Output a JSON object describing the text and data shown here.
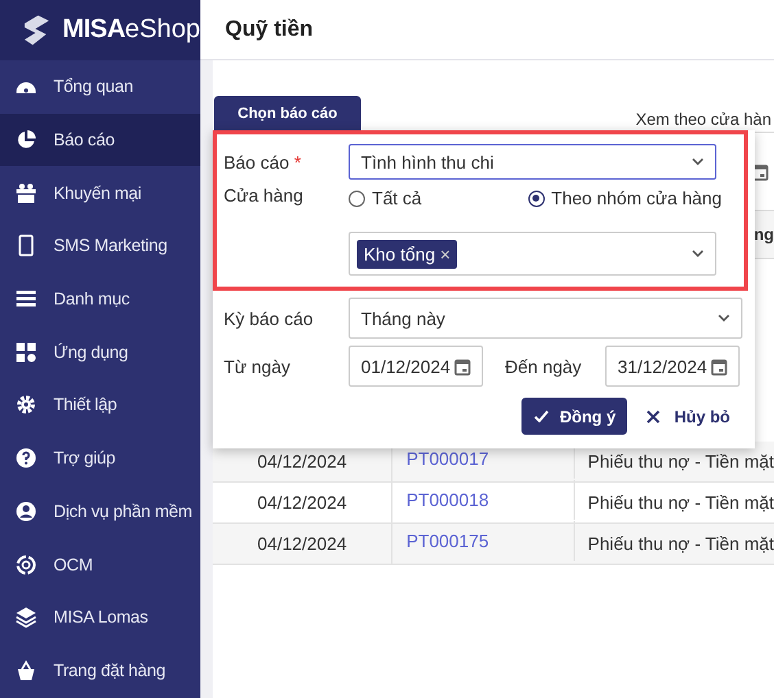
{
  "logo": {
    "brand": "MISA",
    "product": "eShop"
  },
  "sidebar": {
    "items": [
      {
        "label": "Tổng quan",
        "selected": false
      },
      {
        "label": "Báo cáo",
        "selected": true
      },
      {
        "label": "Khuyến mại",
        "selected": false
      },
      {
        "label": "SMS Marketing",
        "selected": false
      },
      {
        "label": "Danh mục",
        "selected": false
      },
      {
        "label": "Ứng dụng",
        "selected": false
      },
      {
        "label": "Thiết lập",
        "selected": false
      },
      {
        "label": "Trợ giúp",
        "selected": false
      },
      {
        "label": "Dịch vụ phần mềm",
        "selected": false
      },
      {
        "label": "OCM",
        "selected": false
      },
      {
        "label": "MISA Lomas",
        "selected": false
      },
      {
        "label": "Trang đặt hàng",
        "selected": false
      }
    ]
  },
  "page_title": "Quỹ tiền",
  "tab": {
    "label": "Chọn báo cáo"
  },
  "background": {
    "view_by": "Xem theo cửa hàn",
    "column_header": "ng"
  },
  "table": {
    "rows": [
      {
        "date": "04/12/2024",
        "code": "PT000017",
        "description": "Phiếu thu nợ - Tiền mặt"
      },
      {
        "date": "04/12/2024",
        "code": "PT000018",
        "description": "Phiếu thu nợ - Tiền mặt"
      },
      {
        "date": "04/12/2024",
        "code": "PT000175",
        "description": "Phiếu thu nợ - Tiền mặt"
      }
    ]
  },
  "dialog": {
    "report": {
      "label": "Báo cáo",
      "required_mark": "*",
      "value": "Tình hình thu chi"
    },
    "store": {
      "label": "Cửa hàng",
      "options": [
        {
          "label": "Tất cả",
          "selected": false
        },
        {
          "label": "Theo nhóm cửa hàng",
          "selected": true
        }
      ],
      "tags": [
        "Kho tổng"
      ],
      "tag_remove": "×"
    },
    "period": {
      "label": "Kỳ báo cáo",
      "value": "Tháng này"
    },
    "from": {
      "label": "Từ ngày",
      "value": "01/12/2024"
    },
    "to": {
      "label": "Đến ngày",
      "value": "31/12/2024"
    },
    "ok": "Đồng ý",
    "cancel": "Hủy bỏ"
  }
}
